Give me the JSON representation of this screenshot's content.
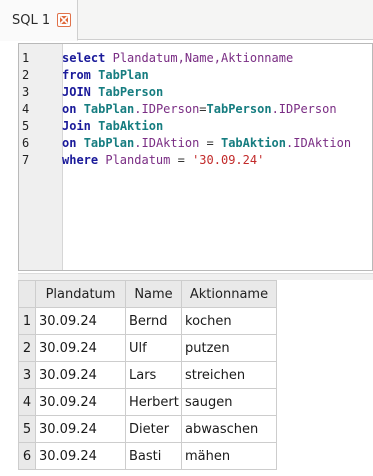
{
  "tabs": [
    {
      "label": "SQL 1"
    }
  ],
  "editor": {
    "line_numbers": [
      "1",
      "2",
      "3",
      "4",
      "5",
      "6",
      "7"
    ],
    "lines": [
      [
        {
          "t": "kw",
          "v": "select"
        },
        {
          "t": "op",
          "v": " "
        },
        {
          "t": "id",
          "v": "Plandatum,Name,Aktionname"
        }
      ],
      [
        {
          "t": "kw",
          "v": "from"
        },
        {
          "t": "op",
          "v": " "
        },
        {
          "t": "tb",
          "v": "TabPlan"
        }
      ],
      [
        {
          "t": "kw",
          "v": "JOIN"
        },
        {
          "t": "op",
          "v": " "
        },
        {
          "t": "tb",
          "v": "TabPerson"
        }
      ],
      [
        {
          "t": "kw",
          "v": "on"
        },
        {
          "t": "op",
          "v": " "
        },
        {
          "t": "tb",
          "v": "TabPlan"
        },
        {
          "t": "id",
          "v": ".IDPerson"
        },
        {
          "t": "op",
          "v": "="
        },
        {
          "t": "tb",
          "v": "TabPerson"
        },
        {
          "t": "id",
          "v": ".IDPerson"
        }
      ],
      [
        {
          "t": "kw",
          "v": "Join"
        },
        {
          "t": "op",
          "v": " "
        },
        {
          "t": "tb",
          "v": "TabAktion"
        }
      ],
      [
        {
          "t": "kw",
          "v": "on"
        },
        {
          "t": "op",
          "v": " "
        },
        {
          "t": "tb",
          "v": "TabPlan"
        },
        {
          "t": "id",
          "v": ".IDAktion"
        },
        {
          "t": "op",
          "v": " = "
        },
        {
          "t": "tb",
          "v": "TabAktion"
        },
        {
          "t": "id",
          "v": ".IDAktion"
        }
      ],
      [
        {
          "t": "kw",
          "v": "where"
        },
        {
          "t": "op",
          "v": " "
        },
        {
          "t": "id",
          "v": "Plandatum"
        },
        {
          "t": "op",
          "v": " = "
        },
        {
          "t": "str",
          "v": "'30.09.24'"
        }
      ]
    ]
  },
  "results": {
    "columns": [
      "Plandatum",
      "Name",
      "Aktionname"
    ],
    "rows": [
      {
        "n": "1",
        "cells": [
          "30.09.24",
          "Bernd",
          "kochen"
        ]
      },
      {
        "n": "2",
        "cells": [
          "30.09.24",
          "Ulf",
          "putzen"
        ]
      },
      {
        "n": "3",
        "cells": [
          "30.09.24",
          "Lars",
          "streichen"
        ]
      },
      {
        "n": "4",
        "cells": [
          "30.09.24",
          "Herbert",
          "saugen"
        ]
      },
      {
        "n": "5",
        "cells": [
          "30.09.24",
          "Dieter",
          "abwaschen"
        ]
      },
      {
        "n": "6",
        "cells": [
          "30.09.24",
          "Basti",
          "mähen"
        ]
      }
    ]
  }
}
